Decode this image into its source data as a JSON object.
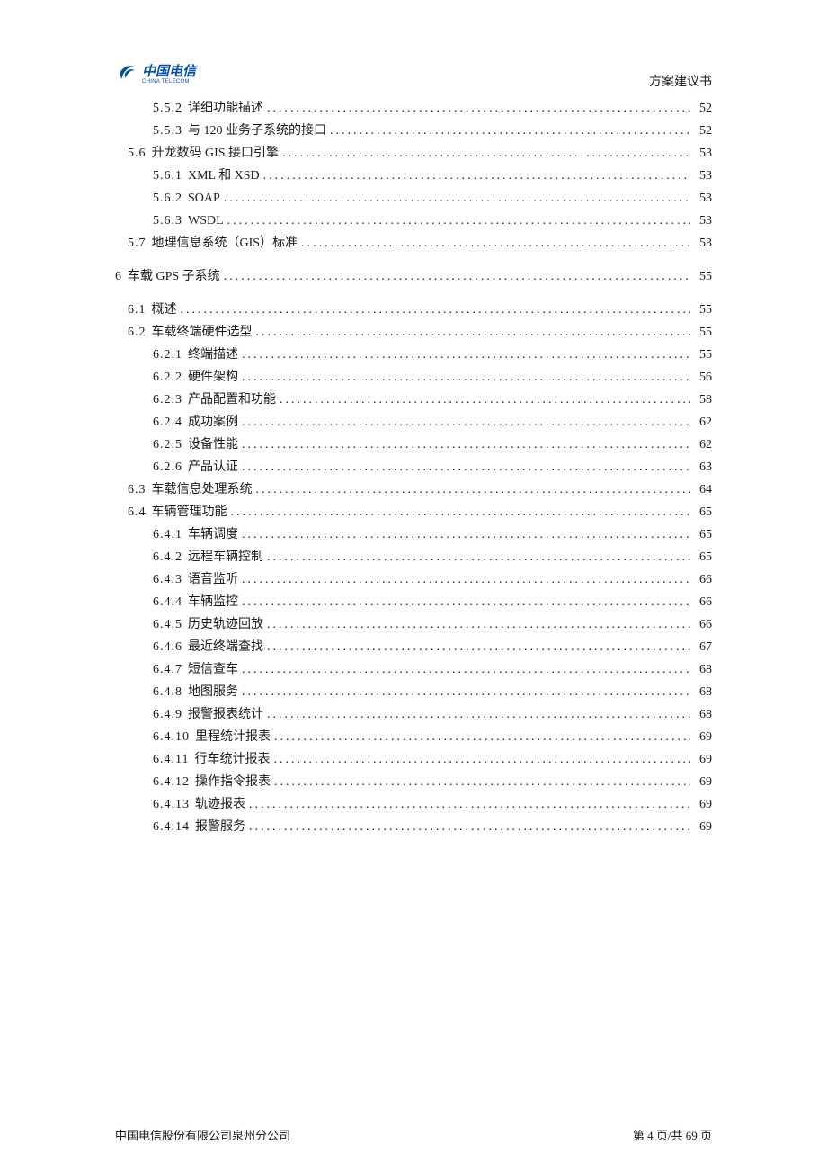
{
  "header": {
    "logo_cn": "中国电信",
    "logo_en": "CHINA TELECOM",
    "doc_title": "方案建议书"
  },
  "toc": [
    {
      "level": 3,
      "num": "5.5.2",
      "label": "详细功能描述",
      "page": "52"
    },
    {
      "level": 3,
      "num": "5.5.3",
      "label": "与 120 业务子系统的接口",
      "page": "52"
    },
    {
      "level": 2,
      "num": "5.6",
      "label": "升龙数码 GIS 接口引擎",
      "page": "53"
    },
    {
      "level": 3,
      "num": "5.6.1",
      "label": "XML 和 XSD",
      "page": "53"
    },
    {
      "level": 3,
      "num": "5.6.2",
      "label": "SOAP",
      "page": "53"
    },
    {
      "level": 3,
      "num": "5.6.3",
      "label": "WSDL",
      "page": "53"
    },
    {
      "level": 2,
      "num": "5.7",
      "label": "地理信息系统（GIS）标准",
      "page": "53"
    },
    {
      "level": 1,
      "num": "6",
      "label": "车载 GPS 子系统",
      "page": "55"
    },
    {
      "level": 2,
      "num": "6.1",
      "label": "概述",
      "page": "55"
    },
    {
      "level": 2,
      "num": "6.2",
      "label": "车载终端硬件选型",
      "page": "55"
    },
    {
      "level": 3,
      "num": "6.2.1",
      "label": "终端描述",
      "page": "55"
    },
    {
      "level": 3,
      "num": "6.2.2",
      "label": "硬件架构",
      "page": "56"
    },
    {
      "level": 3,
      "num": "6.2.3",
      "label": "产品配置和功能",
      "page": "58"
    },
    {
      "level": 3,
      "num": "6.2.4",
      "label": "成功案例",
      "page": "62"
    },
    {
      "level": 3,
      "num": "6.2.5",
      "label": "设备性能",
      "page": "62"
    },
    {
      "level": 3,
      "num": "6.2.6",
      "label": "产品认证",
      "page": "63"
    },
    {
      "level": 2,
      "num": "6.3",
      "label": "车载信息处理系统",
      "page": "64"
    },
    {
      "level": 2,
      "num": "6.4",
      "label": "车辆管理功能",
      "page": "65"
    },
    {
      "level": 3,
      "num": "6.4.1",
      "label": "车辆调度",
      "page": "65"
    },
    {
      "level": 3,
      "num": "6.4.2",
      "label": "远程车辆控制",
      "page": "65"
    },
    {
      "level": 3,
      "num": "6.4.3",
      "label": "语音监听",
      "page": "66"
    },
    {
      "level": 3,
      "num": "6.4.4",
      "label": "车辆监控",
      "page": "66"
    },
    {
      "level": 3,
      "num": "6.4.5",
      "label": "历史轨迹回放",
      "page": "66"
    },
    {
      "level": 3,
      "num": "6.4.6",
      "label": "最近终端查找",
      "page": "67"
    },
    {
      "level": 3,
      "num": "6.4.7",
      "label": "短信查车",
      "page": "68"
    },
    {
      "level": 3,
      "num": "6.4.8",
      "label": "地图服务",
      "page": "68"
    },
    {
      "level": 3,
      "num": "6.4.9",
      "label": "报警报表统计",
      "page": "68"
    },
    {
      "level": 3,
      "num": "6.4.10",
      "label": "里程统计报表",
      "page": "69"
    },
    {
      "level": 3,
      "num": "6.4.11",
      "label": "行车统计报表",
      "page": "69"
    },
    {
      "level": 3,
      "num": "6.4.12",
      "label": "操作指令报表",
      "page": "69"
    },
    {
      "level": 3,
      "num": "6.4.13",
      "label": "轨迹报表",
      "page": "69"
    },
    {
      "level": 3,
      "num": "6.4.14",
      "label": "报警服务",
      "page": "69"
    }
  ],
  "footer": {
    "company": "中国电信股份有限公司泉州分公司",
    "page_label": "第 4 页/共 69 页"
  }
}
